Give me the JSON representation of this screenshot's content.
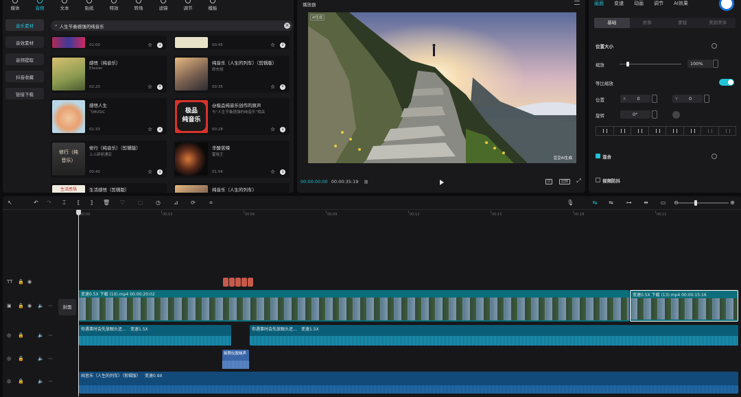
{
  "library": {
    "tabs": [
      {
        "label": "媒体",
        "active": false
      },
      {
        "label": "音频",
        "active": true
      },
      {
        "label": "文本",
        "active": false
      },
      {
        "label": "贴纸",
        "active": false
      },
      {
        "label": "特效",
        "active": false
      },
      {
        "label": "转场",
        "active": false
      },
      {
        "label": "滤镜",
        "active": false
      },
      {
        "label": "调节",
        "active": false
      },
      {
        "label": "模板",
        "active": false
      }
    ],
    "side_items": [
      {
        "label": "音乐素材",
        "active": true
      },
      {
        "label": "音效素材",
        "active": false
      },
      {
        "label": "音频提取",
        "active": false
      },
      {
        "label": "抖音收藏",
        "active": false
      },
      {
        "label": "链接下载",
        "active": false
      }
    ],
    "search_value": "人生节奏感强的纯音乐",
    "cards": [
      {
        "title": "",
        "artist": "",
        "duration": "01:00"
      },
      {
        "title": "",
        "artist": "",
        "duration": "00:45"
      },
      {
        "title": "感悟（纯音乐）",
        "artist": "Elwizer",
        "duration": "02:20"
      },
      {
        "title": "纯音乐（人生的列车）（剪辑版）",
        "artist": "郎东旭",
        "duration": "00:35"
      },
      {
        "title": "感悟人生",
        "artist": "飞MUSIC",
        "duration": "01:33"
      },
      {
        "title": "@极品纯音乐创作的原声",
        "artist": "与“人生节奏感强的纯音乐”相关",
        "duration": "00:28"
      },
      {
        "title": "修行（纯音乐）（剪辑版）",
        "artist": "上上辟邪通宏",
        "duration": "00:40"
      },
      {
        "title": "辛酸苦辣",
        "artist": "霍晓王",
        "duration": "01:56"
      },
      {
        "title": "生活感悟（剪辑版）",
        "artist": "",
        "duration": ""
      },
      {
        "title": "纯音乐（人生的列车）",
        "artist": "",
        "duration": ""
      }
    ],
    "thumb_texts": {
      "jipin": "极品\n纯音乐",
      "xiuxing": "修行（纯\n音乐）",
      "shenghuo": "生活感悟"
    }
  },
  "player": {
    "title": "播放器",
    "ai_badge": "AI生成",
    "watermark": "豆豆AI生成",
    "current_time": "00:00:00:00",
    "total_time": "00:00:35:19",
    "ratio_label": "比例"
  },
  "properties": {
    "tabs": [
      {
        "label": "画面",
        "active": true
      },
      {
        "label": "变速",
        "active": false
      },
      {
        "label": "动画",
        "active": false
      },
      {
        "label": "调节",
        "active": false
      },
      {
        "label": "AI效果",
        "active": false
      }
    ],
    "subtabs": [
      {
        "label": "基础",
        "active": true
      },
      {
        "label": "抠像",
        "active": false
      },
      {
        "label": "蒙版",
        "active": false
      },
      {
        "label": "美颜美体",
        "active": false
      }
    ],
    "section_size": "位置大小",
    "scale_label": "缩放",
    "scale_value": "100%",
    "scale_level": 0.12,
    "uniform_label": "等比缩放",
    "uniform_on": true,
    "position_label": "位置",
    "pos_x_label": "X",
    "pos_x": "0",
    "pos_y_label": "Y",
    "pos_y": "0",
    "rotate_label": "旋转",
    "rotate_value": "0°",
    "blend_label": "混合",
    "stabilize_label": "视频防抖",
    "accent": "#21c3d6"
  },
  "timeline": {
    "ruler": [
      "00:00",
      "00:03",
      "00:06",
      "00:09",
      "00:12",
      "00:15",
      "00:18",
      "00:21"
    ],
    "cover_label": "封面",
    "video_clip1": "变速0.5X  下载 (10).mp4  00:00:20:02",
    "video_clip2": "变速0.5X  下载 (13).mp4  00:00:15:16",
    "audio_clip1a": "你遇事时会先放眼头还…",
    "audio_clip1b": "变速1.5X",
    "audio_clip2a": "你遇事时会先放眼头还…",
    "audio_clip2b": "变速1.5X",
    "sfx_label": "拍照仪胶映声",
    "music_clip": "纯音乐（人生的列车）（剪辑版）",
    "music_speed": "变速0.9X"
  }
}
